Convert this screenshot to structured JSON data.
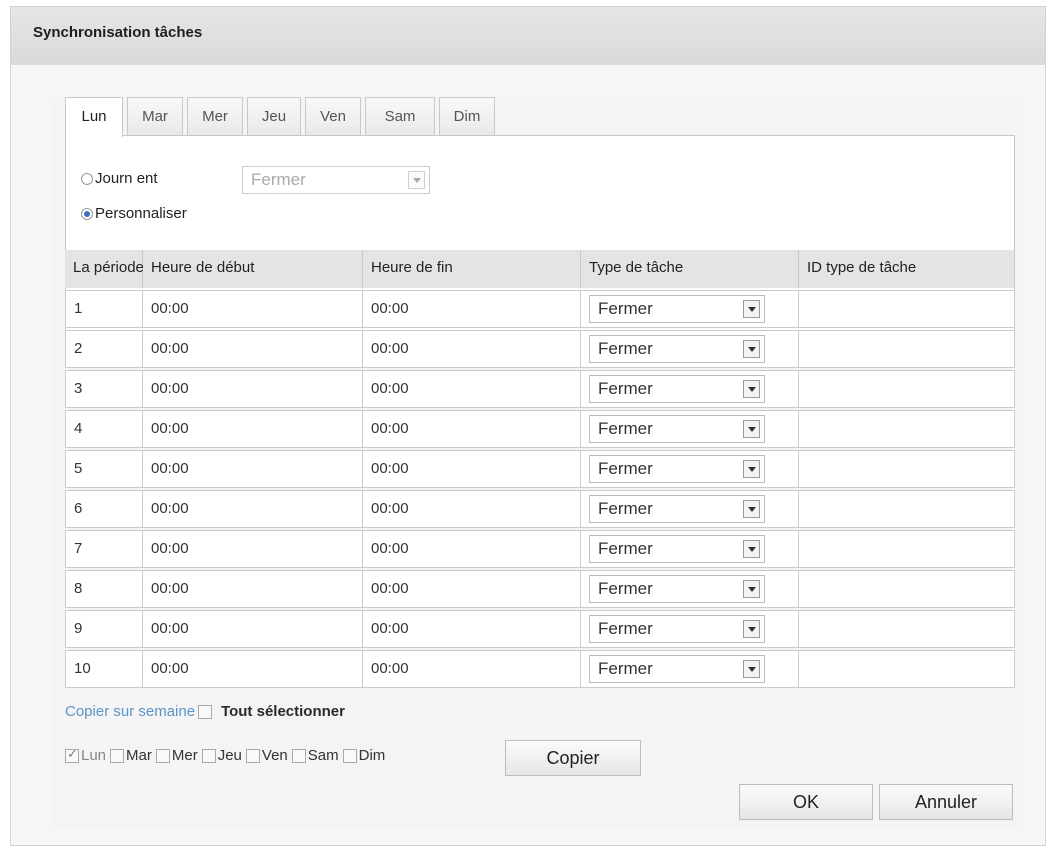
{
  "dialog": {
    "title": "Synchronisation tâches"
  },
  "tabs": [
    "Lun",
    "Mar",
    "Mer",
    "Jeu",
    "Ven",
    "Sam",
    "Dim"
  ],
  "active_tab": "Lun",
  "mode": {
    "full_day_label": "Journ ent",
    "full_day_select": "Fermer",
    "custom_label": "Personnaliser",
    "selected": "custom"
  },
  "table": {
    "headers": [
      "La période",
      "Heure de début",
      "Heure de fin",
      "Type de tâche",
      "ID type de tâche"
    ],
    "rows": [
      {
        "period": "1",
        "start": "00:00",
        "end": "00:00",
        "type": "Fermer",
        "id": ""
      },
      {
        "period": "2",
        "start": "00:00",
        "end": "00:00",
        "type": "Fermer",
        "id": ""
      },
      {
        "period": "3",
        "start": "00:00",
        "end": "00:00",
        "type": "Fermer",
        "id": ""
      },
      {
        "period": "4",
        "start": "00:00",
        "end": "00:00",
        "type": "Fermer",
        "id": ""
      },
      {
        "period": "5",
        "start": "00:00",
        "end": "00:00",
        "type": "Fermer",
        "id": ""
      },
      {
        "period": "6",
        "start": "00:00",
        "end": "00:00",
        "type": "Fermer",
        "id": ""
      },
      {
        "period": "7",
        "start": "00:00",
        "end": "00:00",
        "type": "Fermer",
        "id": ""
      },
      {
        "period": "8",
        "start": "00:00",
        "end": "00:00",
        "type": "Fermer",
        "id": ""
      },
      {
        "period": "9",
        "start": "00:00",
        "end": "00:00",
        "type": "Fermer",
        "id": ""
      },
      {
        "period": "10",
        "start": "00:00",
        "end": "00:00",
        "type": "Fermer",
        "id": ""
      }
    ]
  },
  "copy": {
    "link_label": "Copier sur semaine",
    "select_all_label": "Tout sélectionner",
    "days": [
      {
        "label": "Lun",
        "checked": true
      },
      {
        "label": "Mar",
        "checked": false
      },
      {
        "label": "Mer",
        "checked": false
      },
      {
        "label": "Jeu",
        "checked": false
      },
      {
        "label": "Ven",
        "checked": false
      },
      {
        "label": "Sam",
        "checked": false
      },
      {
        "label": "Dim",
        "checked": false
      }
    ],
    "copy_button": "Copier"
  },
  "footer": {
    "ok_label": "OK",
    "cancel_label": "Annuler"
  },
  "colors": {
    "link": "#5b95c8",
    "title_bar": "#dcdcdc",
    "radio_dot": "#3a6fc0"
  }
}
